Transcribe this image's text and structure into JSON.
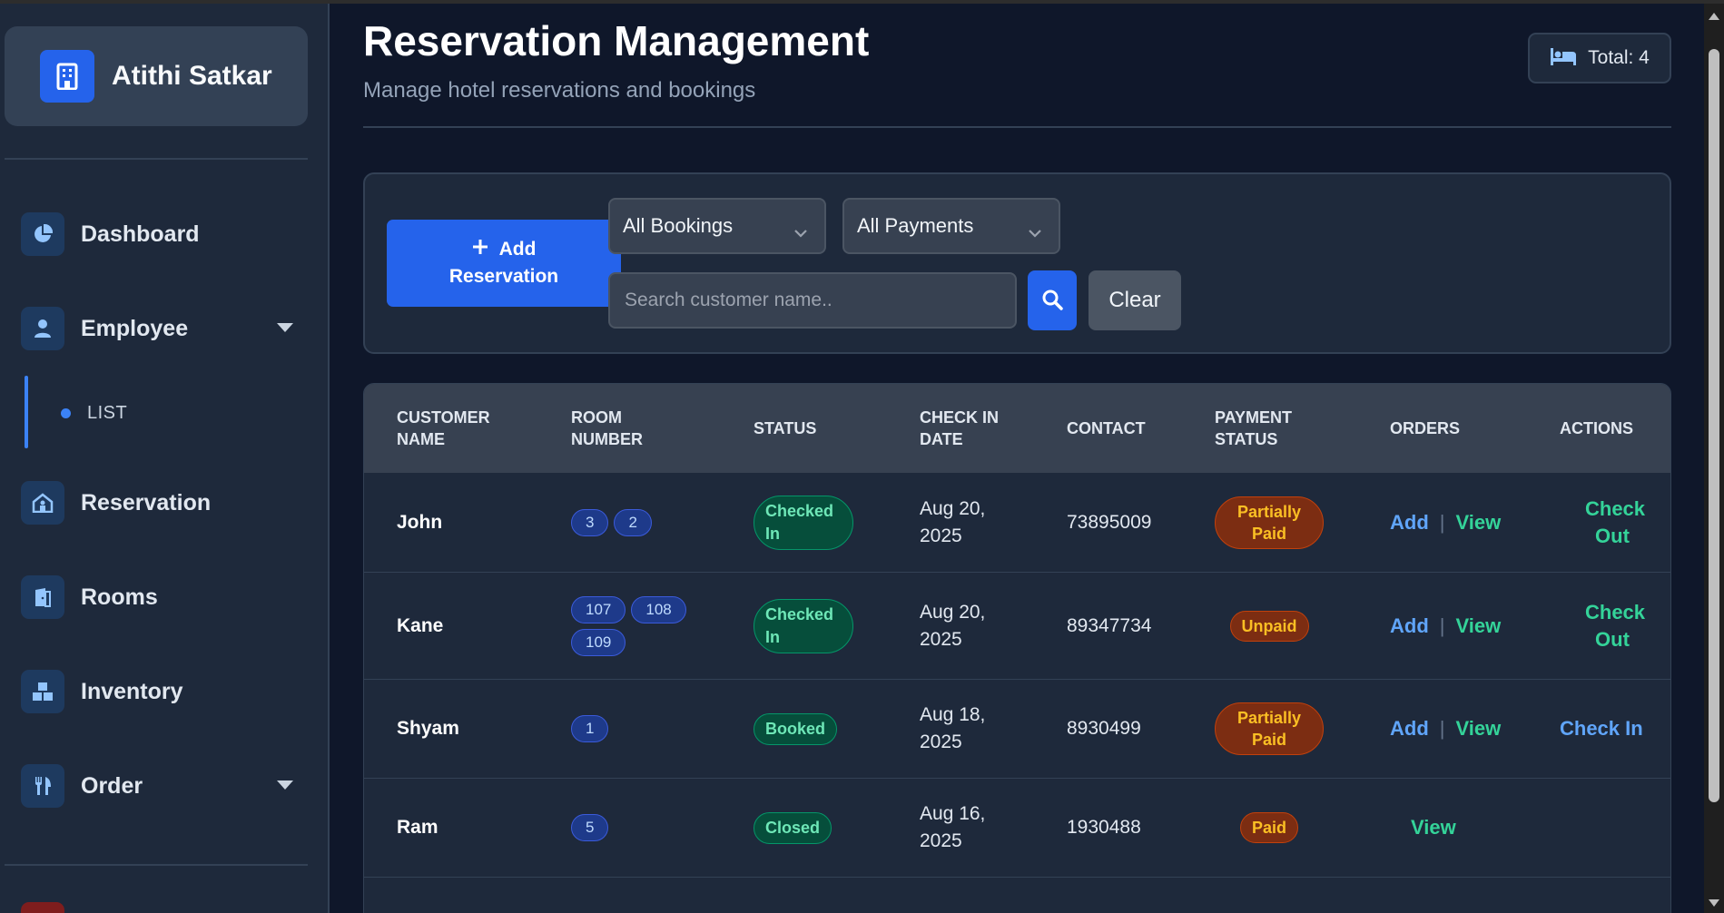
{
  "brand": {
    "name": "Atithi Satkar",
    "icon": "building-icon"
  },
  "sidebar": {
    "items": [
      {
        "label": "Dashboard",
        "icon": "pie-chart-icon"
      },
      {
        "label": "Employee",
        "icon": "user-icon",
        "expandable": true,
        "expanded": true
      },
      {
        "label": "Reservation",
        "icon": "hotel-icon"
      },
      {
        "label": "Rooms",
        "icon": "door-icon"
      },
      {
        "label": "Inventory",
        "icon": "boxes-icon"
      },
      {
        "label": "Order",
        "icon": "utensils-icon",
        "expandable": true
      }
    ],
    "employee_sub": [
      {
        "label": "LIST"
      }
    ]
  },
  "header": {
    "title": "Reservation Management",
    "subtitle": "Manage hotel reservations and bookings",
    "total_label": "Total: 4",
    "total_icon": "bed-icon"
  },
  "filters": {
    "add_button_line1": "Add",
    "add_button_line2": "Reservation",
    "booking_select": "All Bookings",
    "payment_select": "All Payments",
    "search_placeholder": "Search customer name..",
    "clear_label": "Clear"
  },
  "table": {
    "headers": {
      "customer": "CUSTOMER NAME",
      "room": "ROOM NUMBER",
      "status": "STATUS",
      "checkin": "CHECK IN DATE",
      "contact": "CONTACT",
      "payment": "PAYMENT STATUS",
      "orders": "ORDERS",
      "actions": "ACTIONS"
    },
    "rows": [
      {
        "customer": "John",
        "rooms": [
          "3",
          "2"
        ],
        "status": "Checked In",
        "checkin": "Aug 20, 2025",
        "contact": "73895009",
        "payment": "Partially Paid",
        "order_add": "Add",
        "order_view": "View",
        "action": "Check Out"
      },
      {
        "customer": "Kane",
        "rooms": [
          "107",
          "108",
          "109"
        ],
        "status": "Checked In",
        "checkin": "Aug 20, 2025",
        "contact": "89347734",
        "payment": "Unpaid",
        "order_add": "Add",
        "order_view": "View",
        "action": "Check Out"
      },
      {
        "customer": "Shyam",
        "rooms": [
          "1"
        ],
        "status": "Booked",
        "checkin": "Aug 18, 2025",
        "contact": "8930499",
        "payment": "Partially Paid",
        "order_add": "Add",
        "order_view": "View",
        "action": "Check In"
      },
      {
        "customer": "Ram",
        "rooms": [
          "5"
        ],
        "status": "Closed",
        "checkin": "Aug 16, 2025",
        "contact": "1930488",
        "payment": "Paid",
        "order_view": "View",
        "action": ""
      }
    ]
  },
  "colors": {
    "accent": "#2563eb",
    "bg": "#0f172a",
    "panel": "#1e293b",
    "success": "#34d399",
    "link": "#60a5fa"
  }
}
